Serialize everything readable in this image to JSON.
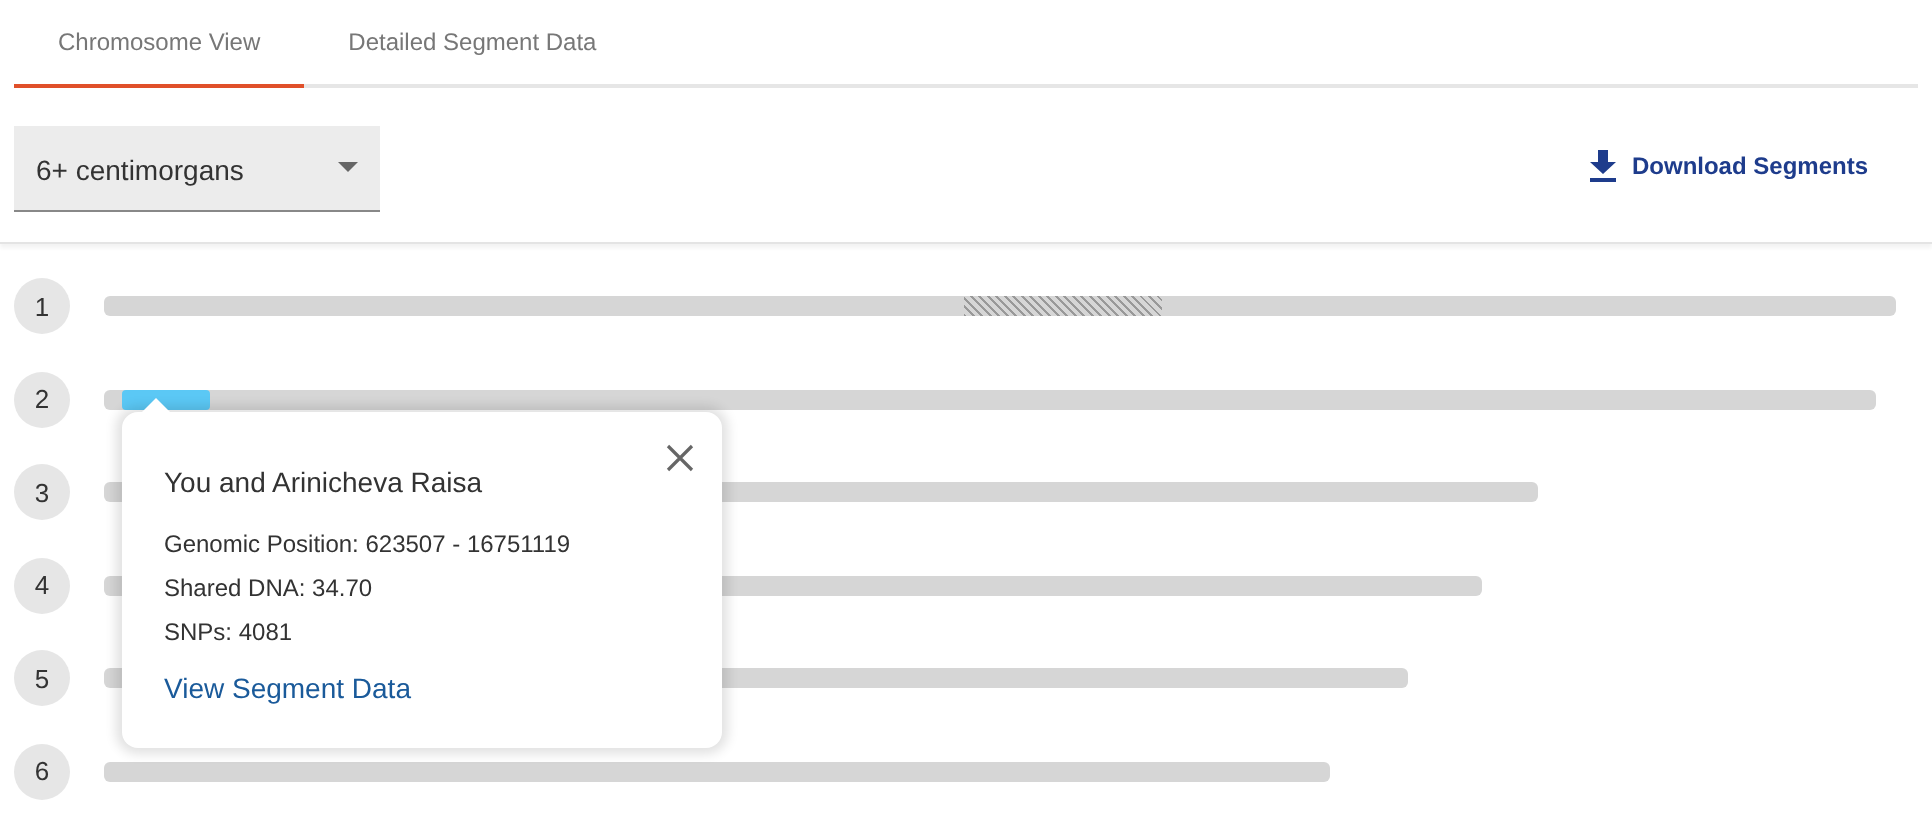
{
  "tabs": [
    {
      "label": "Chromosome View",
      "selected": true
    },
    {
      "label": "Detailed Segment Data",
      "selected": false
    }
  ],
  "filter": {
    "value": "6+ centimorgans"
  },
  "download": {
    "label": "Download Segments"
  },
  "chromosomes": [
    {
      "number": "1",
      "hatched": true,
      "highlighted": false
    },
    {
      "number": "2",
      "hatched": false,
      "highlighted": true
    },
    {
      "number": "3",
      "hatched": false,
      "highlighted": false
    },
    {
      "number": "4",
      "hatched": false,
      "highlighted": false
    },
    {
      "number": "5",
      "hatched": false,
      "highlighted": false
    },
    {
      "number": "6",
      "hatched": false,
      "highlighted": false
    }
  ],
  "popup": {
    "title": "You and Arinicheva Raisa",
    "lines": [
      {
        "label": "Genomic Position:",
        "value": "623507 - 16751119"
      },
      {
        "label": "Shared DNA:",
        "value": "34.70"
      },
      {
        "label": "SNPs:",
        "value": "4081"
      }
    ],
    "link": "View Segment Data"
  }
}
